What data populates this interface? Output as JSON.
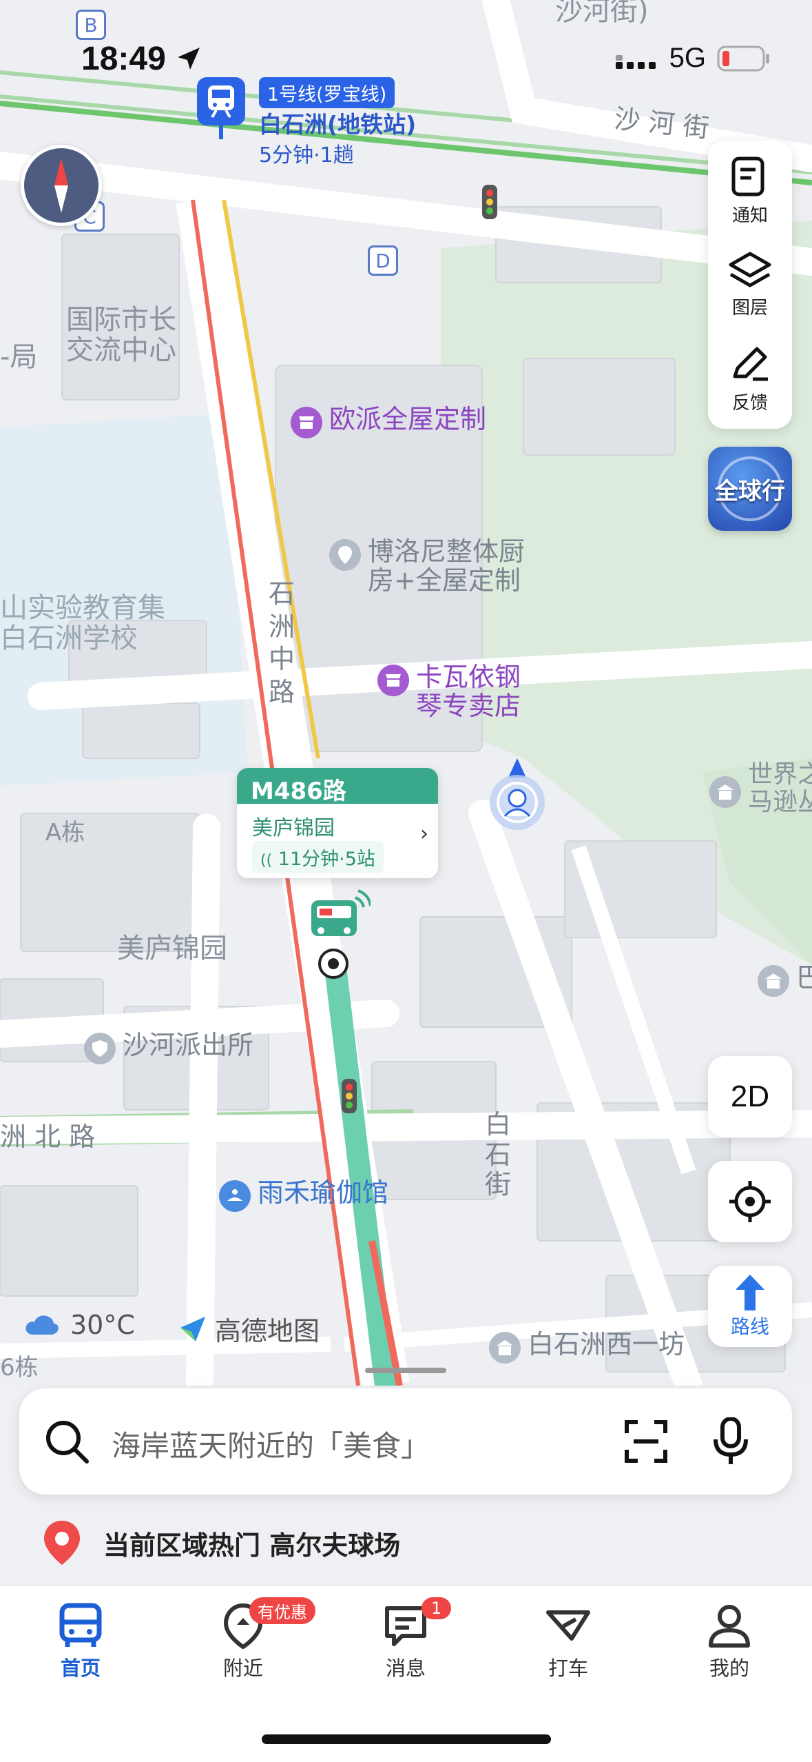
{
  "status_bar": {
    "time": "18:49",
    "network": "5G"
  },
  "metro": {
    "line": "1号线(罗宝线)",
    "station": "白石洲(地铁站)",
    "eta": "5分钟·1趟"
  },
  "exits": {
    "b": "B",
    "c": "C",
    "d": "D"
  },
  "map_labels": {
    "sha_he_jie_top": "沙河街)",
    "sha_he_jie": "沙 河 街",
    "intl_mayor_1": "国际市长",
    "intl_mayor_2": "交流中心",
    "ju": "-局",
    "school_1": "山实验教育集",
    "school_2": "白石洲学校",
    "shizhou_road": [
      "石",
      "洲",
      "中",
      "路"
    ],
    "a_building": "A栋",
    "meilu_area": "美庐锦园",
    "zhou_north": "洲 北 路",
    "baishi_street": [
      "白",
      "石",
      "街"
    ],
    "six_building": "6栋",
    "world": "世界之",
    "mazun": "马逊丛"
  },
  "pois": {
    "oupai": "欧派全屋定制",
    "boloni_1": "博洛尼整体厨",
    "boloni_2": "房+全屋定制",
    "kawayi_1": "卡瓦依钢",
    "kawayi_2": "琴专卖店",
    "police": "沙河派出所",
    "yoga": "雨禾瑜伽馆",
    "baishi_west": "白石洲西一坊",
    "ba": "巴"
  },
  "right_tools": {
    "notice": "通知",
    "layers": "图层",
    "feedback": "反馈",
    "globe_badge": "全球行",
    "mode_2d": "2D",
    "route": "路线"
  },
  "bus_callout": {
    "route": "M486路",
    "stop": "美庐锦园",
    "eta": "11分钟·5站"
  },
  "weather": {
    "temp": "30°C"
  },
  "brand": "高德地图",
  "search": {
    "placeholder": "海岸蓝天附近的「美食」"
  },
  "hot_area": {
    "text": "当前区域热门 高尔夫球场"
  },
  "tabs": [
    {
      "label": "首页"
    },
    {
      "label": "附近",
      "badge": "有优惠"
    },
    {
      "label": "消息",
      "badge": "1"
    },
    {
      "label": "打车"
    },
    {
      "label": "我的"
    }
  ],
  "colors": {
    "accent": "#1a5fd6",
    "bus_green": "#3aa88a",
    "badge_red": "#f04545",
    "poi_purple": "#9b4dca"
  }
}
